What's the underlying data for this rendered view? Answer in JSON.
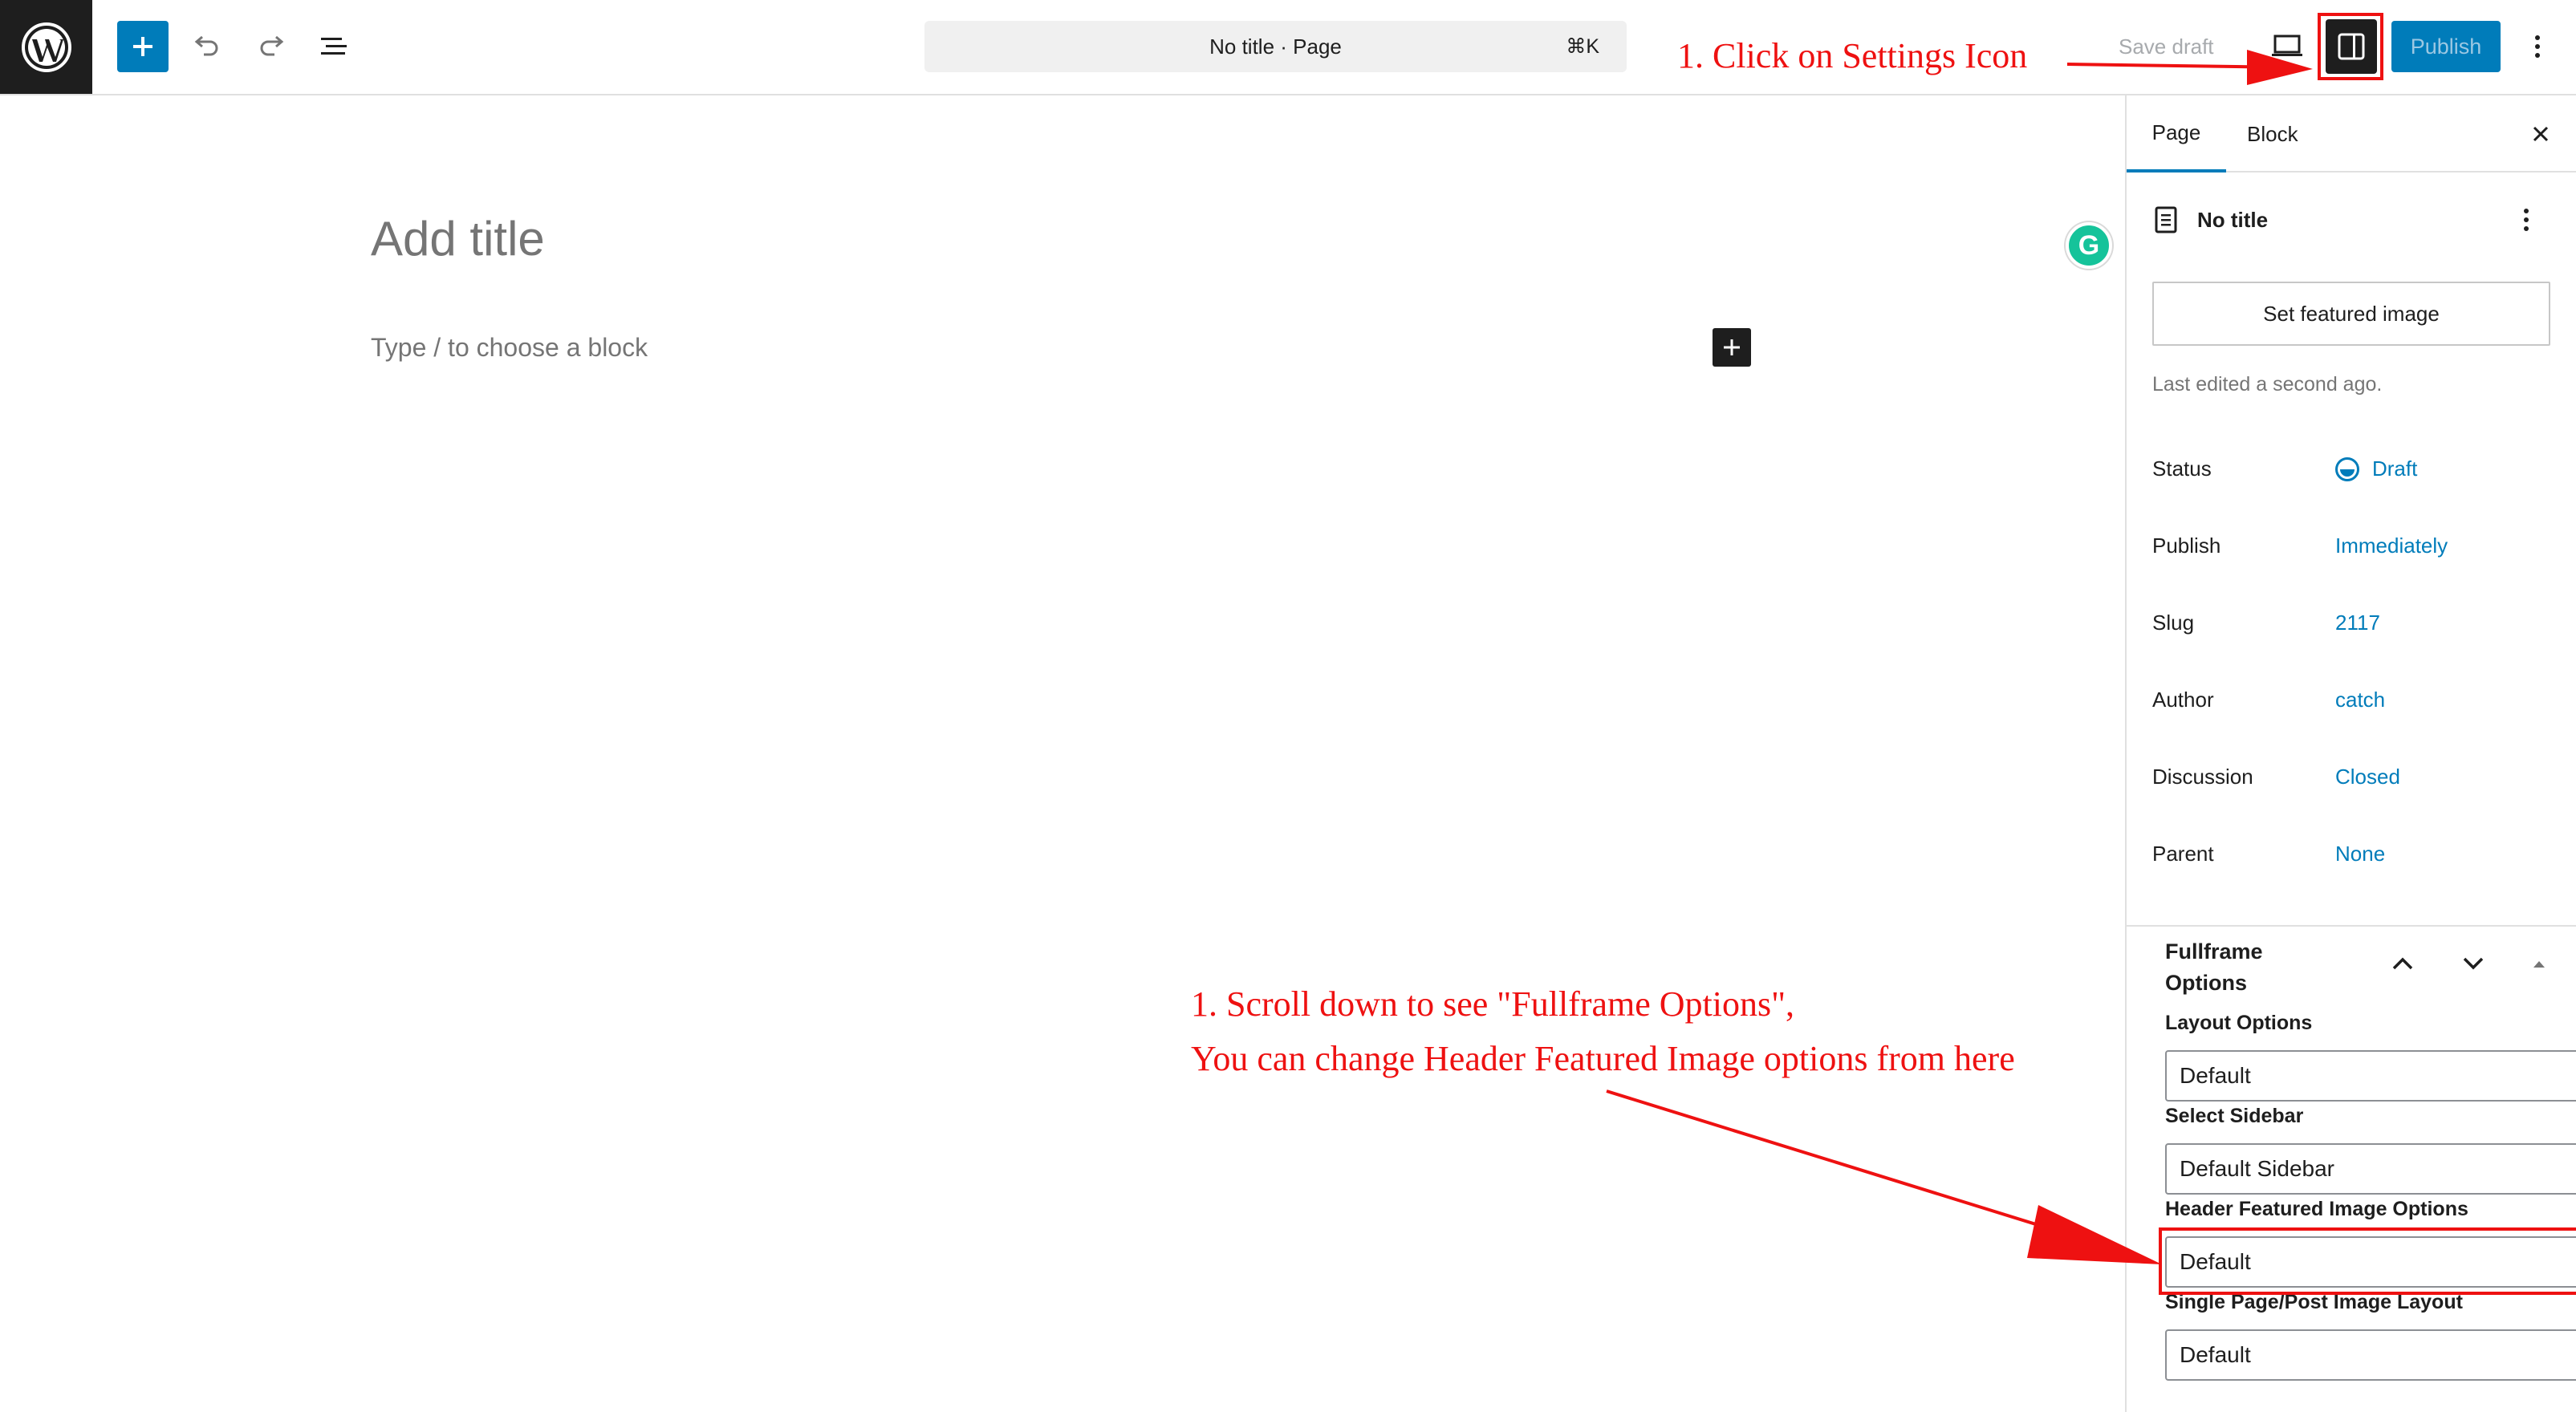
{
  "topbar": {
    "doc_title": "No title · Page",
    "shortcut": "⌘K",
    "save_draft": "Save draft",
    "publish": "Publish"
  },
  "editor": {
    "title_placeholder": "Add title",
    "block_placeholder": "Type / to choose a block",
    "grammarly_letter": "G"
  },
  "sidebar": {
    "tabs": [
      "Page",
      "Block"
    ],
    "doc_title": "No title",
    "featured_image_button": "Set featured image",
    "last_edited": "Last edited a second ago.",
    "meta": [
      {
        "label": "Status",
        "value": "Draft"
      },
      {
        "label": "Publish",
        "value": "Immediately"
      },
      {
        "label": "Slug",
        "value": "2117"
      },
      {
        "label": "Author",
        "value": "catch"
      },
      {
        "label": "Discussion",
        "value": "Closed"
      },
      {
        "label": "Parent",
        "value": "None"
      }
    ],
    "fullframe": {
      "title": "Fullframe Options",
      "fields": [
        {
          "label": "Layout Options",
          "value": "Default"
        },
        {
          "label": "Select Sidebar",
          "value": "Default Sidebar"
        },
        {
          "label": "Header Featured Image Options",
          "value": "Default"
        },
        {
          "label": "Single Page/Post Image Layout",
          "value": "Default"
        }
      ]
    }
  },
  "annotations": {
    "settings_hint": "1. Click on Settings Icon",
    "scroll_hint_line1": "1. Scroll down to see \"Fullframe Options\",",
    "scroll_hint_line2": "You can change Header Featured Image options from here",
    "color": "#ee1111"
  },
  "colors": {
    "accent": "#007cba",
    "dark": "#1e1e1e",
    "muted": "#757575"
  }
}
